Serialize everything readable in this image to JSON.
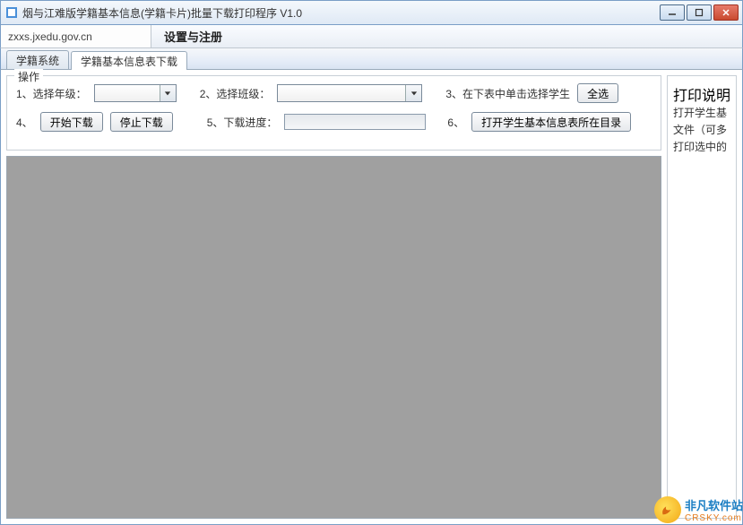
{
  "window": {
    "title": "烟与江难版学籍基本信息(学籍卡片)批量下载打印程序 V1.0"
  },
  "toolbar": {
    "address": "zxxs.jxedu.gov.cn",
    "settings": "设置与注册"
  },
  "tabs": {
    "t1": "学籍系统",
    "t2": "学籍基本信息表下载"
  },
  "ops": {
    "legend": "操作",
    "row1": {
      "l1": "1、选择年级：",
      "l2": "2、选择班级：",
      "l3": "3、在下表中单击选择学生",
      "selectAll": "全选"
    },
    "row2": {
      "l4": "4、",
      "start": "开始下载",
      "stop": "停止下载",
      "l5": "5、下载进度：",
      "l6": "6、",
      "openDir": "打开学生基本信息表所在目录"
    }
  },
  "print": {
    "legend": "打印说明",
    "line1": "打开学生基",
    "line2": "文件（可多",
    "line3": "打印选中的"
  },
  "watermark": {
    "cn": "非凡软件站",
    "en": "CRSKY.com"
  }
}
